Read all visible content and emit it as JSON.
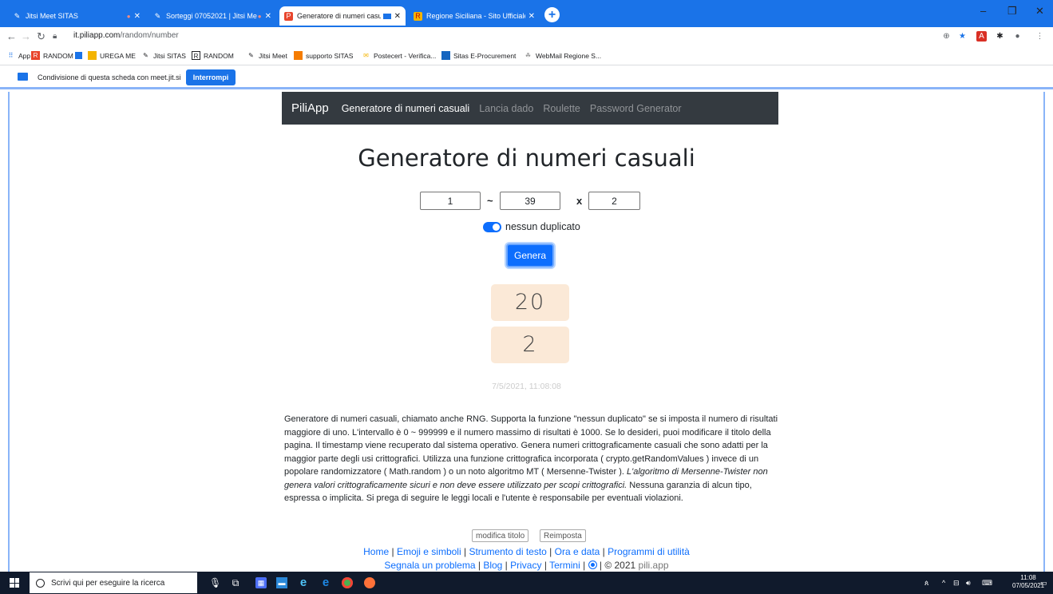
{
  "browser": {
    "tabs": [
      {
        "title": "Jitsi Meet SITAS",
        "icon": "jitsi-icon",
        "recording": true,
        "active": false
      },
      {
        "title": "Sorteggi 07052021 | Jitsi Me",
        "icon": "jitsi-icon",
        "recording": true,
        "active": false
      },
      {
        "title": "Generatore di numeri casuali",
        "icon": "piliapp-icon",
        "recording": false,
        "sharing": true,
        "active": true
      },
      {
        "title": "Regione Siciliana - Sito Ufficiale",
        "icon": "regione-icon",
        "recording": false,
        "active": false
      }
    ],
    "url_host": "it.piliapp.com",
    "url_path": "/random/number",
    "bookmarks": [
      "App",
      "RANDOM",
      "UREGA ME",
      "Jitsi SITAS",
      "RANDOM",
      "Jitsi Meet",
      "supporto SITAS",
      "Postecert - Verifica...",
      "Sitas E-Procurement",
      "WebMail Regione S..."
    ],
    "share_text": "Condivisione di questa scheda con meet.jit.si",
    "stop_label": "Interrompi"
  },
  "site": {
    "brand": "PiliApp",
    "nav": [
      "Generatore di numeri casuali",
      "Lancia dado",
      "Roulette",
      "Password Generator"
    ],
    "title": "Generatore di numeri casuali",
    "min": "1",
    "range_sep": "~",
    "max": "39",
    "times_sep": "x",
    "count": "2",
    "toggle_label": "nessun duplicato",
    "toggle_on": true,
    "generate_label": "Genera",
    "results": [
      "20",
      "2"
    ],
    "timestamp": "7/5/2021, 11:08:08",
    "desc_part1": "Generatore di numeri casuali, chiamato anche RNG. Supporta la funzione \"nessun duplicato\" se si imposta il numero di risultati maggiore di uno. L'intervallo è 0 ~ 999999 e il numero massimo di risultati è 1000. Se lo desideri, puoi modificare il titolo della pagina. Il timestamp viene recuperato dal sistema operativo. Genera numeri crittograficamente casuali che sono adatti per la maggior parte degli usi crittografici. Utilizza una funzione crittografica incorporata ( crypto.getRandomValues ) invece di un popolare randomizzatore ( Math.random ) o un noto algoritmo MT ( Mersenne-Twister ). ",
    "desc_italic": "L'algoritmo di Mersenne-Twister non genera valori crittograficamente sicuri e non deve essere utilizzato per scopi crittografici.",
    "desc_part2": " Nessuna garanzia di alcun tipo, espressa o implicita. Si prega di seguire le leggi locali e l'utente è responsabile per eventuali violazioni.",
    "edit_title_label": "modifica titolo",
    "reset_label": "Reimposta",
    "footer_links1": [
      "Home",
      "Emoji e simboli",
      "Strumento di testo",
      "Ora e data",
      "Programmi di utilità"
    ],
    "footer_links2": [
      "Segnala un problema",
      "Blog",
      "Privacy",
      "Termini"
    ],
    "footer_copyright": "© 2021",
    "footer_site": "pili.app"
  },
  "taskbar": {
    "search_placeholder": "Scrivi qui per eseguire la ricerca",
    "time": "11:08",
    "date": "07/05/2021"
  },
  "colors": {
    "chrome_blue": "#1a73e8",
    "nav_dark": "#343a40",
    "primary": "#0d6efd",
    "result_bg": "#fbe9d7",
    "taskbar": "#101a2c"
  }
}
